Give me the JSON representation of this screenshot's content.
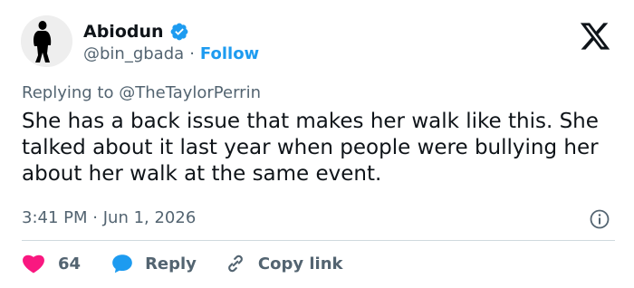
{
  "author": {
    "name": "Abiodun",
    "handle": "@bin_gbada",
    "separator": "·",
    "follow_label": "Follow",
    "avatar_icon": "silhouette-avatar",
    "verified_icon": "verified-badge-icon"
  },
  "reply_context": {
    "prefix": "Replying to",
    "mention": "@TheTaylorPerrin"
  },
  "tweet": {
    "text": "She has a back issue that makes her walk like this. She talked about it last year when people were bullying her about her walk at the same event.",
    "time": "3:41 PM",
    "separator": "·",
    "date": "Jun 1, 2026"
  },
  "actions": {
    "like_count": "64",
    "reply_label": "Reply",
    "copy_link_label": "Copy link"
  },
  "colors": {
    "accent": "#1d9bf0",
    "like": "#f91880",
    "muted_text": "#536471",
    "text": "#0f1419",
    "divider": "#cfd9de"
  }
}
